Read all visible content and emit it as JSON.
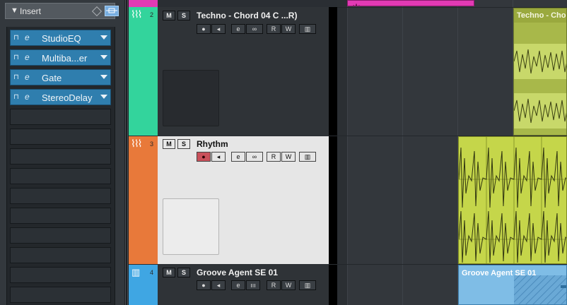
{
  "inspector": {
    "section_title": "Insert",
    "slots": [
      {
        "name": "StudioEQ"
      },
      {
        "name": "Multiba...er"
      },
      {
        "name": "Gate"
      },
      {
        "name": "StereoDelay"
      },
      {
        "name": ""
      },
      {
        "name": ""
      },
      {
        "name": ""
      },
      {
        "name": ""
      },
      {
        "name": ""
      },
      {
        "name": ""
      },
      {
        "name": ""
      },
      {
        "name": ""
      },
      {
        "name": ""
      },
      {
        "name": ""
      }
    ]
  },
  "tracks": [
    {
      "number": "2",
      "name": "Techno - Chord 04 C ...R)",
      "color": "#33d49c",
      "type": "audio"
    },
    {
      "number": "3",
      "name": "Rhythm",
      "color": "#e8793a",
      "type": "audio",
      "selected": true,
      "record_enabled": true
    },
    {
      "number": "4",
      "name": "Groove Agent SE 01",
      "color": "#3fa6e3",
      "type": "instrument"
    }
  ],
  "track_buttons": {
    "mute": "M",
    "solo": "S",
    "read": "R",
    "write": "W",
    "edit": "e",
    "link": "∞",
    "midi": "ııı"
  },
  "events": {
    "track2": "Techno - Chord",
    "track4": "Groove Agent SE 01"
  },
  "colors": {
    "accent_blue": "#2f7eae",
    "top_event": "#e23ab4",
    "audio_event_green": "#a8b84a",
    "rhythm_event": "#c5d64a",
    "groove_event": "#7fbde6"
  }
}
